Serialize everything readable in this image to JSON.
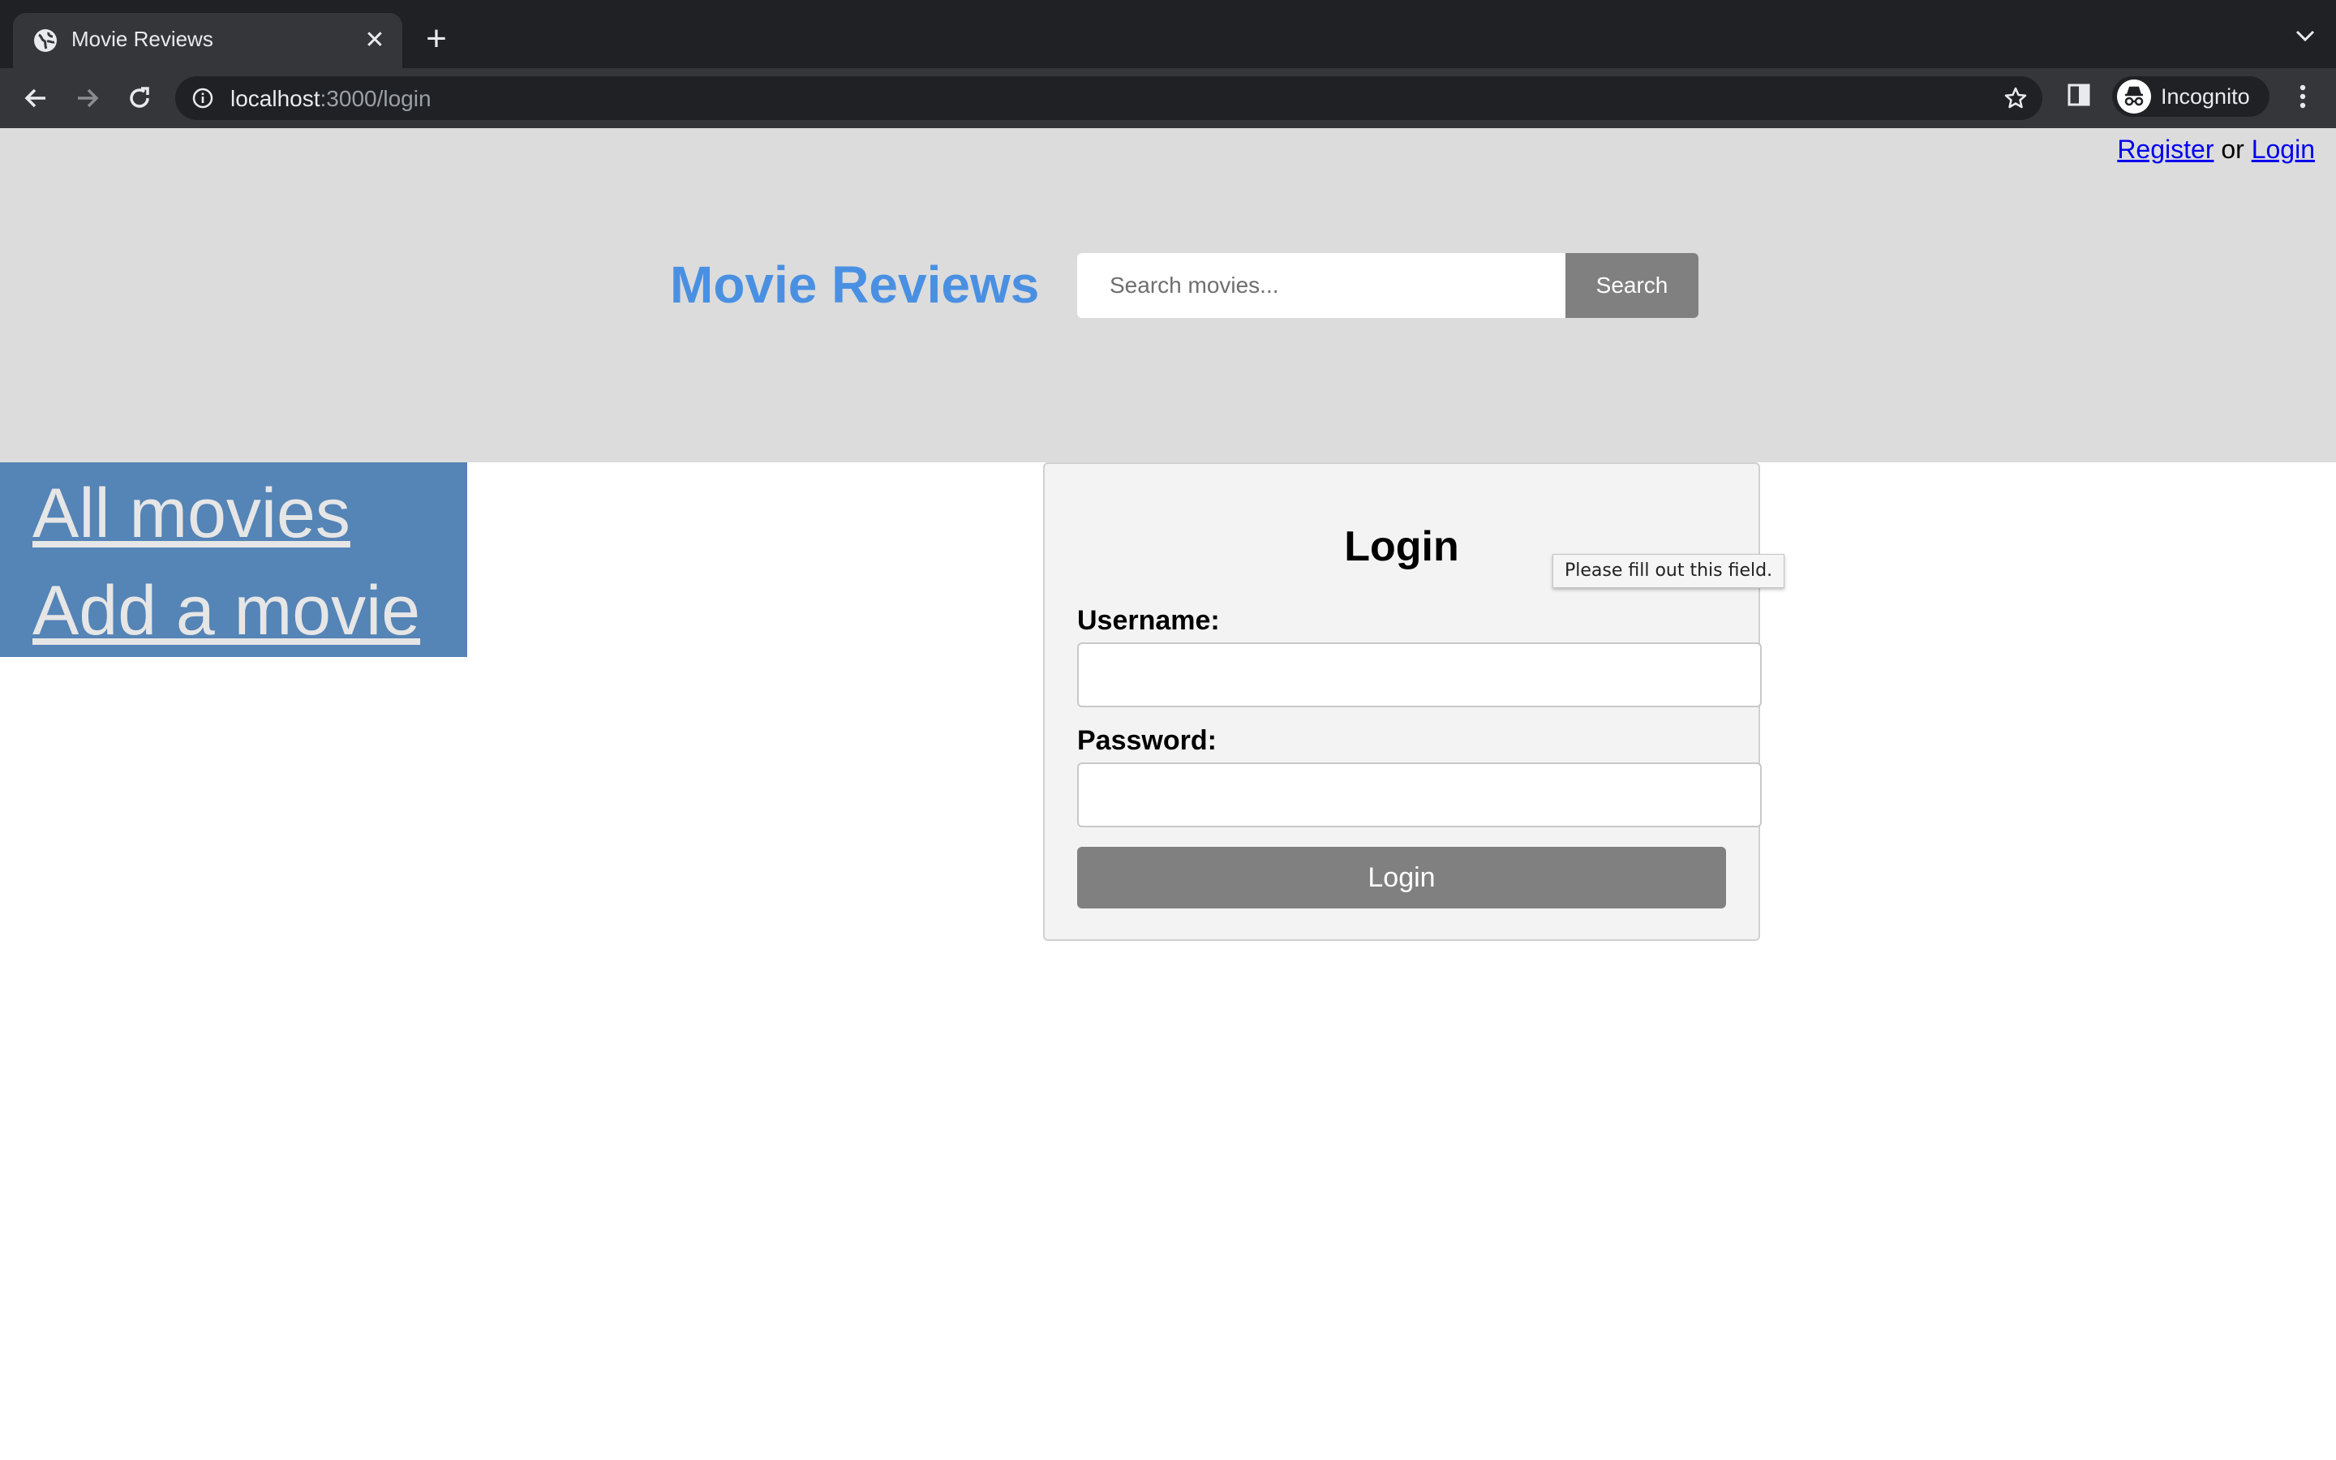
{
  "browser": {
    "tab": {
      "title": "Movie Reviews"
    },
    "address": {
      "host": "localhost",
      "path": ":3000/login"
    },
    "profile": {
      "label": "Incognito"
    }
  },
  "header": {
    "auth": {
      "register": "Register",
      "separator": "or",
      "login": "Login"
    },
    "site_title": "Movie Reviews",
    "search": {
      "placeholder": "Search movies...",
      "button_label": "Search"
    }
  },
  "sidebar": {
    "items": [
      {
        "label": "All movies"
      },
      {
        "label": "Add a movie"
      }
    ]
  },
  "login_form": {
    "heading": "Login",
    "username_label": "Username:",
    "username_value": "",
    "password_label": "Password:",
    "password_value": "",
    "submit_label": "Login",
    "validation_tooltip": "Please fill out this field."
  },
  "colors": {
    "site_title": "#4a90e2",
    "header_bg": "#dcdcdc",
    "sidebar_bg": "#5584b6",
    "button_bg": "#808080"
  }
}
